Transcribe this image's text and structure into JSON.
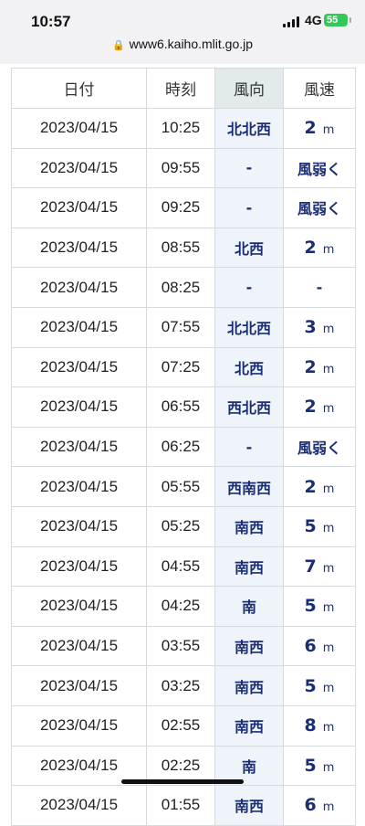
{
  "status_bar": {
    "time": "10:57",
    "network": "4G",
    "battery": "55"
  },
  "browser": {
    "url": "www6.kaiho.mlit.go.jp"
  },
  "table": {
    "headers": [
      "日付",
      "時刻",
      "風向",
      "風速"
    ],
    "rows": [
      {
        "date": "2023/04/15",
        "time": "10:25",
        "dir": "北北西",
        "speed": "2",
        "unit": "m"
      },
      {
        "date": "2023/04/15",
        "time": "09:55",
        "dir": "-",
        "speed": "風弱く",
        "unit": ""
      },
      {
        "date": "2023/04/15",
        "time": "09:25",
        "dir": "-",
        "speed": "風弱く",
        "unit": ""
      },
      {
        "date": "2023/04/15",
        "time": "08:55",
        "dir": "北西",
        "speed": "2",
        "unit": "m"
      },
      {
        "date": "2023/04/15",
        "time": "08:25",
        "dir": "-",
        "speed": "-",
        "unit": ""
      },
      {
        "date": "2023/04/15",
        "time": "07:55",
        "dir": "北北西",
        "speed": "3",
        "unit": "m"
      },
      {
        "date": "2023/04/15",
        "time": "07:25",
        "dir": "北西",
        "speed": "2",
        "unit": "m"
      },
      {
        "date": "2023/04/15",
        "time": "06:55",
        "dir": "西北西",
        "speed": "2",
        "unit": "m"
      },
      {
        "date": "2023/04/15",
        "time": "06:25",
        "dir": "-",
        "speed": "風弱く",
        "unit": ""
      },
      {
        "date": "2023/04/15",
        "time": "05:55",
        "dir": "西南西",
        "speed": "2",
        "unit": "m"
      },
      {
        "date": "2023/04/15",
        "time": "05:25",
        "dir": "南西",
        "speed": "5",
        "unit": "m"
      },
      {
        "date": "2023/04/15",
        "time": "04:55",
        "dir": "南西",
        "speed": "7",
        "unit": "m"
      },
      {
        "date": "2023/04/15",
        "time": "04:25",
        "dir": "南",
        "speed": "5",
        "unit": "m"
      },
      {
        "date": "2023/04/15",
        "time": "03:55",
        "dir": "南西",
        "speed": "6",
        "unit": "m"
      },
      {
        "date": "2023/04/15",
        "time": "03:25",
        "dir": "南西",
        "speed": "5",
        "unit": "m"
      },
      {
        "date": "2023/04/15",
        "time": "02:55",
        "dir": "南西",
        "speed": "8",
        "unit": "m"
      },
      {
        "date": "2023/04/15",
        "time": "02:25",
        "dir": "南",
        "speed": "5",
        "unit": "m"
      },
      {
        "date": "2023/04/15",
        "time": "01:55",
        "dir": "南西",
        "speed": "6",
        "unit": "m"
      }
    ]
  }
}
